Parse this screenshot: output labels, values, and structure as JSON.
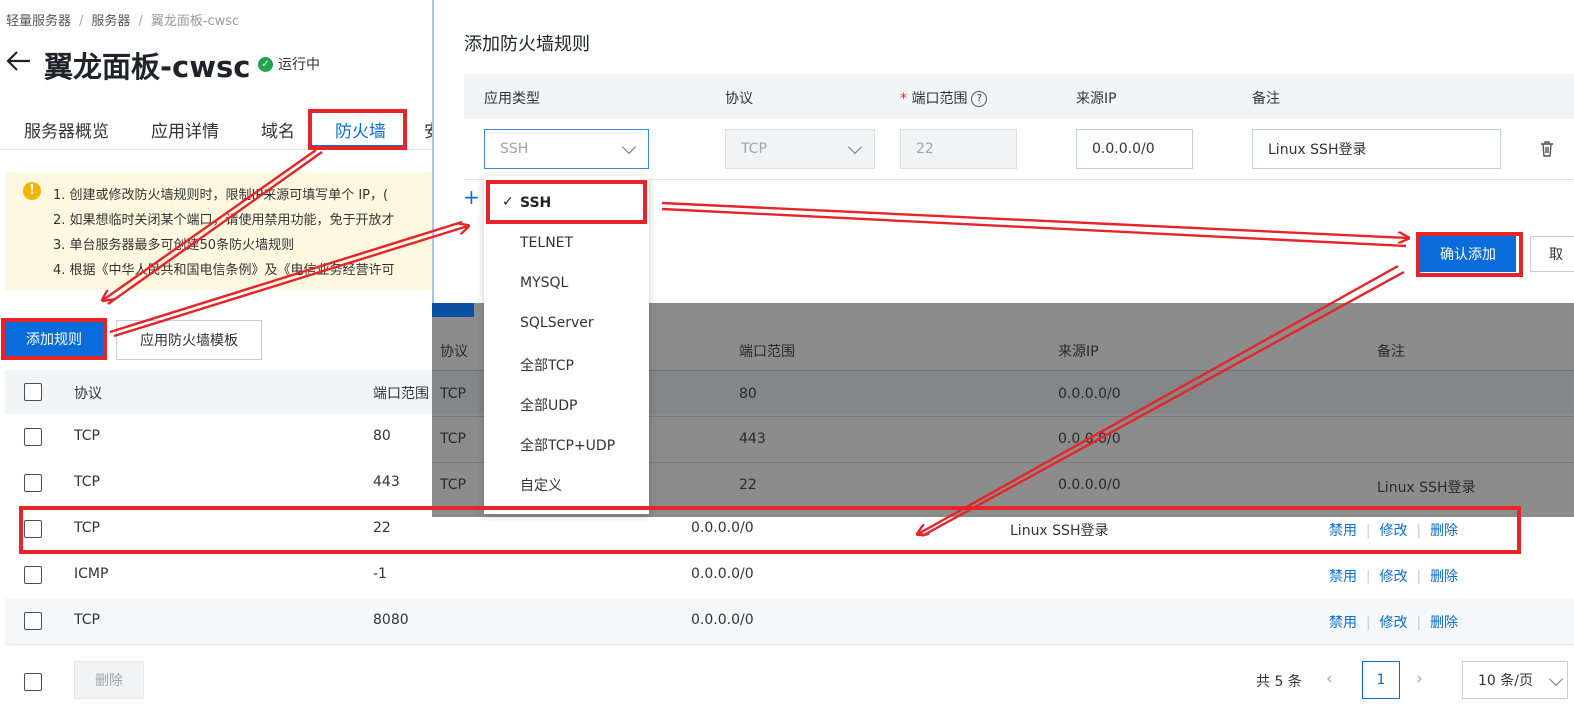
{
  "breadcrumb": [
    "轻量服务器",
    "服务器",
    "翼龙面板-cwsc"
  ],
  "page": {
    "title": "翼龙面板-cwsc",
    "status": "运行中"
  },
  "tabs": [
    "服务器概览",
    "应用详情",
    "域名",
    "防火墙",
    "安"
  ],
  "notice": [
    "1. 创建或修改防火墙规则时，限制IP来源可填写单个 IP，(",
    "2. 如果想临时关闭某个端口，请使用禁用功能，免于开放才",
    "3. 单台服务器最多可创建50条防火墙规则",
    "4. 根据《中华人民共和国电信条例》及《电信业务经营许可"
  ],
  "toolbar": {
    "add_rule": "添加规则",
    "apply_template": "应用防火墙模板"
  },
  "table": {
    "columns": [
      "协议",
      "端口范围"
    ],
    "rows": [
      {
        "protocol": "TCP",
        "port": "80",
        "source": "",
        "note": ""
      },
      {
        "protocol": "TCP",
        "port": "443",
        "source": "",
        "note": ""
      },
      {
        "protocol": "TCP",
        "port": "22",
        "source": "0.0.0.0/0",
        "note": "Linux SSH登录"
      },
      {
        "protocol": "ICMP",
        "port": "-1",
        "source": "0.0.0.0/0",
        "note": ""
      },
      {
        "protocol": "TCP",
        "port": "8080",
        "source": "0.0.0.0/0",
        "note": ""
      }
    ],
    "actions": {
      "disable": "禁用",
      "edit": "修改",
      "delete": "删除"
    },
    "batch_delete": "删除"
  },
  "pagination": {
    "total": "共 5 条",
    "page": "1",
    "page_size": "10 条/页"
  },
  "background_table": {
    "columns": [
      "协议",
      "端口范围",
      "来源IP",
      "备注"
    ],
    "rows": [
      {
        "protocol": "TCP",
        "port": "80",
        "source": "0.0.0.0/0",
        "note": ""
      },
      {
        "protocol": "TCP",
        "port": "443",
        "source": "0.0.0.0/0",
        "note": ""
      },
      {
        "protocol": "TCP",
        "port": "22",
        "source": "0.0.0.0/0",
        "note": "Linux SSH登录"
      }
    ]
  },
  "dialog": {
    "title": "添加防火墙规则",
    "columns": {
      "app_type": "应用类型",
      "protocol": "协议",
      "port_range": "端口范围",
      "source_ip": "来源IP",
      "note": "备注"
    },
    "row": {
      "app_type": "SSH",
      "protocol": "TCP",
      "port": "22",
      "source_ip": "0.0.0.0/0",
      "note": "Linux SSH登录"
    },
    "add_row": "+",
    "confirm": "确认添加",
    "cancel": "取"
  },
  "dropdown": {
    "options": [
      "SSH",
      "TELNET",
      "MYSQL",
      "SQLServer",
      "全部TCP",
      "全部UDP",
      "全部TCP+UDP",
      "自定义"
    ],
    "selected": "SSH"
  },
  "colors": {
    "primary": "#0a6cda",
    "annotation": "#e5252a",
    "warning_bg": "#fff8e0",
    "success": "#21a44f"
  }
}
